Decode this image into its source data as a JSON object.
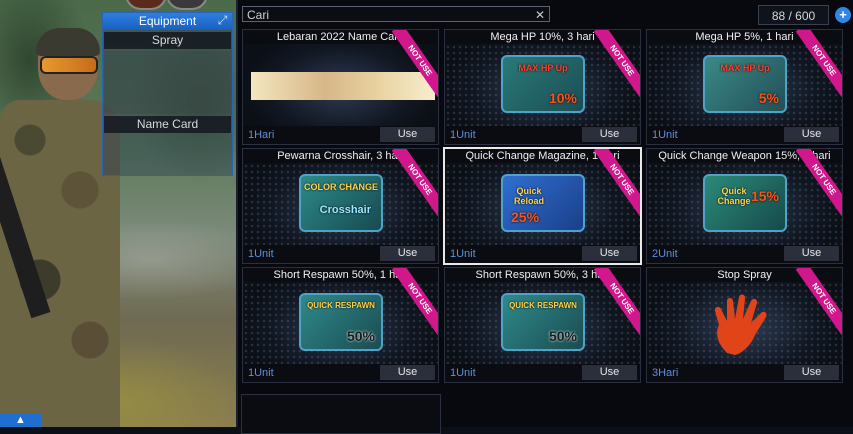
{
  "search": {
    "value": "Cari"
  },
  "counter": {
    "text": "88 / 600"
  },
  "equipment": {
    "title": "Equipment",
    "spray": "Spray",
    "name_card": "Name Card"
  },
  "items": [
    {
      "name": "Lebaran 2022 Name Card",
      "duration": "1Hari",
      "use": "Use",
      "badge": "NOT USE"
    },
    {
      "name": "Mega HP 10%, 3 hari",
      "duration": "1Unit",
      "use": "Use",
      "badge": "NOT USE",
      "icon_text": "MAX HP Up",
      "icon_value": "10%"
    },
    {
      "name": "Mega HP 5%, 1 hari",
      "duration": "1Unit",
      "use": "Use",
      "badge": "NOT USE",
      "icon_text": "MAX HP Up",
      "icon_value": "5%"
    },
    {
      "name": "Pewarna Crosshair, 3 hari",
      "duration": "1Unit",
      "use": "Use",
      "badge": "NOT USE",
      "icon_text": "COLOR CHANGE",
      "icon_value": "Crosshair"
    },
    {
      "name": "Quick Change Magazine, 1 hari",
      "duration": "1Unit",
      "use": "Use",
      "badge": "NOT USE",
      "icon_text": "Quick Reload",
      "icon_value": "25%"
    },
    {
      "name": "Quick Change Weapon 15%, 1 hari",
      "duration": "2Unit",
      "use": "Use",
      "badge": "NOT USE",
      "icon_text": "Quick Change",
      "icon_value": "15%"
    },
    {
      "name": "Short Respawn 50%, 1 hari",
      "duration": "1Unit",
      "use": "Use",
      "badge": "NOT USE",
      "icon_text": "QUICK RESPAWN",
      "icon_value": "50%"
    },
    {
      "name": "Short Respawn 50%, 3 hari",
      "duration": "1Unit",
      "use": "Use",
      "badge": "NOT USE",
      "icon_text": "QUICK RESPAWN",
      "icon_value": "50%"
    },
    {
      "name": "Stop Spray",
      "duration": "3Hari",
      "use": "Use",
      "badge": "NOT USE"
    }
  ],
  "colors": {
    "accent": "#2e86e6",
    "badge": "#d0188c",
    "duration": "#5e8fdb"
  }
}
